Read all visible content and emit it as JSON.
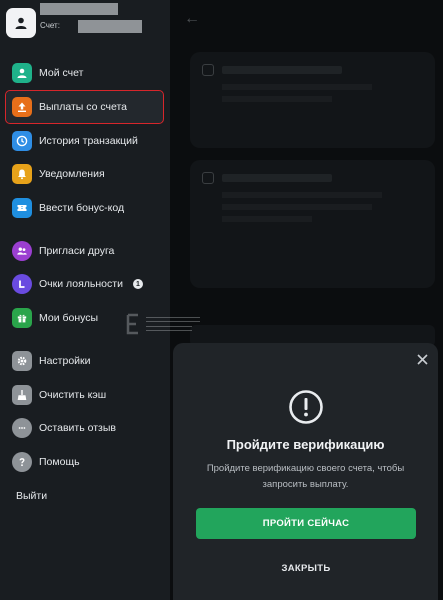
{
  "profile": {
    "account_label": "Счет:"
  },
  "sidebar": {
    "items": [
      {
        "label": "Мой счет",
        "icon": "user-circle-icon",
        "color": "#1fb28a"
      },
      {
        "label": "Выплаты со счета",
        "icon": "upload-icon",
        "color": "#e76f1a"
      },
      {
        "label": "История транзакций",
        "icon": "clock-icon",
        "color": "#2f8ee5"
      },
      {
        "label": "Уведомления",
        "icon": "bell-icon",
        "color": "#e7a21a"
      },
      {
        "label": "Ввести бонус-код",
        "icon": "ticket-icon",
        "color": "#1f8fe0"
      },
      {
        "label": "Пригласи друга",
        "icon": "people-icon",
        "color": "#9b3fd1"
      },
      {
        "label": "Очки лояльности",
        "icon": "loyalty-icon",
        "color": "#6a4be0",
        "badge": "1"
      },
      {
        "label": "Мои бонусы",
        "icon": "gift-icon",
        "color": "#2aa54b"
      },
      {
        "label": "Настройки",
        "icon": "gear-icon",
        "color": "#8e9398"
      },
      {
        "label": "Очистить кэш",
        "icon": "broom-icon",
        "color": "#8e9398"
      },
      {
        "label": "Оставить отзыв",
        "icon": "chat-icon",
        "color": "#8e9398"
      },
      {
        "label": "Помощь",
        "icon": "help-icon",
        "color": "#8e9398"
      }
    ],
    "logout_label": "Выйти"
  },
  "modal": {
    "title": "Пройдите верификацию",
    "description": "Пройдите верификацию своего счета, чтобы запросить выплату.",
    "primary_button": "ПРОЙТИ СЕЙЧАС",
    "secondary_button": "ЗАКРЫТЬ",
    "accent_color": "#22a55c"
  }
}
